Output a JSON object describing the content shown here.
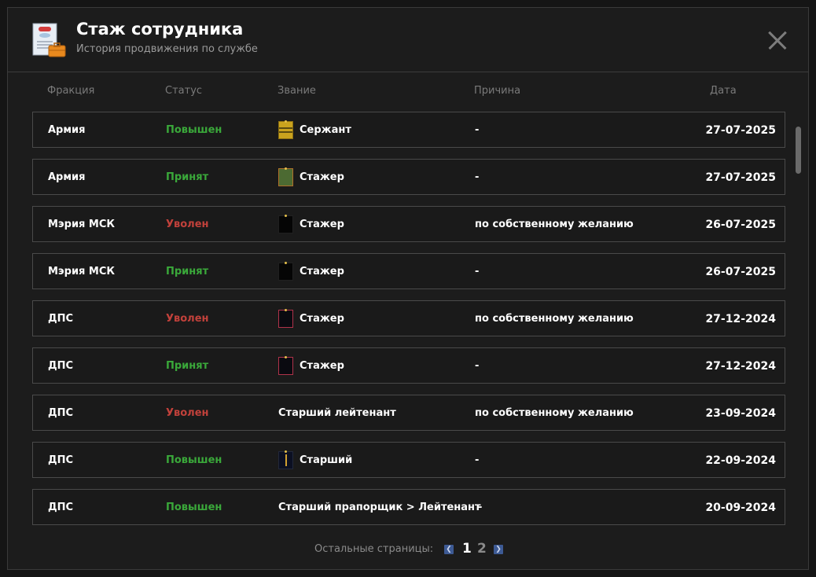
{
  "header": {
    "title": "Стаж сотрудника",
    "subtitle": "История продвижения по службе"
  },
  "columns": {
    "faction": "Фракция",
    "status": "Статус",
    "rank": "Звание",
    "reason": "Причина",
    "date": "Дата"
  },
  "rows": [
    {
      "faction": "Армия",
      "status": "Повышен",
      "status_color": "#3aa83a",
      "rank": "Сержант",
      "rank_icon": "sergeant-shoulder-strap-icon",
      "reason": "-",
      "date": "27-07-2025"
    },
    {
      "faction": "Армия",
      "status": "Принят",
      "status_color": "#3aa83a",
      "rank": "Стажер",
      "rank_icon": "army-trainee-shoulder-strap-icon",
      "reason": "-",
      "date": "27-07-2025"
    },
    {
      "faction": "Мэрия МСК",
      "status": "Уволен",
      "status_color": "#c2413b",
      "rank": "Стажер",
      "rank_icon": "black-shoulder-strap-icon",
      "reason": "по собственному желанию",
      "date": "26-07-2025"
    },
    {
      "faction": "Мэрия МСК",
      "status": "Принят",
      "status_color": "#3aa83a",
      "rank": "Стажер",
      "rank_icon": "black-shoulder-strap-icon",
      "reason": "-",
      "date": "26-07-2025"
    },
    {
      "faction": "ДПС",
      "status": "Уволен",
      "status_color": "#c2413b",
      "rank": "Стажер",
      "rank_icon": "police-shoulder-strap-icon",
      "reason": "по собственному желанию",
      "date": "27-12-2024"
    },
    {
      "faction": "ДПС",
      "status": "Принят",
      "status_color": "#3aa83a",
      "rank": "Стажер",
      "rank_icon": "police-shoulder-strap-icon",
      "reason": "-",
      "date": "27-12-2024"
    },
    {
      "faction": "ДПС",
      "status": "Уволен",
      "status_color": "#c2413b",
      "rank": "Старший лейтенант",
      "rank_icon": "",
      "reason": "по собственному желанию",
      "date": "23-09-2024"
    },
    {
      "faction": "ДПС",
      "status": "Повышен",
      "status_color": "#3aa83a",
      "rank": "Старший",
      "rank_icon": "senior-shoulder-strap-icon",
      "reason": "-",
      "date": "22-09-2024"
    },
    {
      "faction": "ДПС",
      "status": "Повышен",
      "status_color": "#3aa83a",
      "rank": "Старший прапорщик > Лейтенант",
      "rank_icon": "",
      "reason": "-",
      "date": "20-09-2024"
    }
  ],
  "pager": {
    "label": "Остальные страницы:",
    "pages": [
      "1",
      "2"
    ],
    "current": "1"
  },
  "colors": {
    "promoted": "#3aa83a",
    "fired": "#c2413b",
    "pager_arrow": "#3d5a94"
  }
}
